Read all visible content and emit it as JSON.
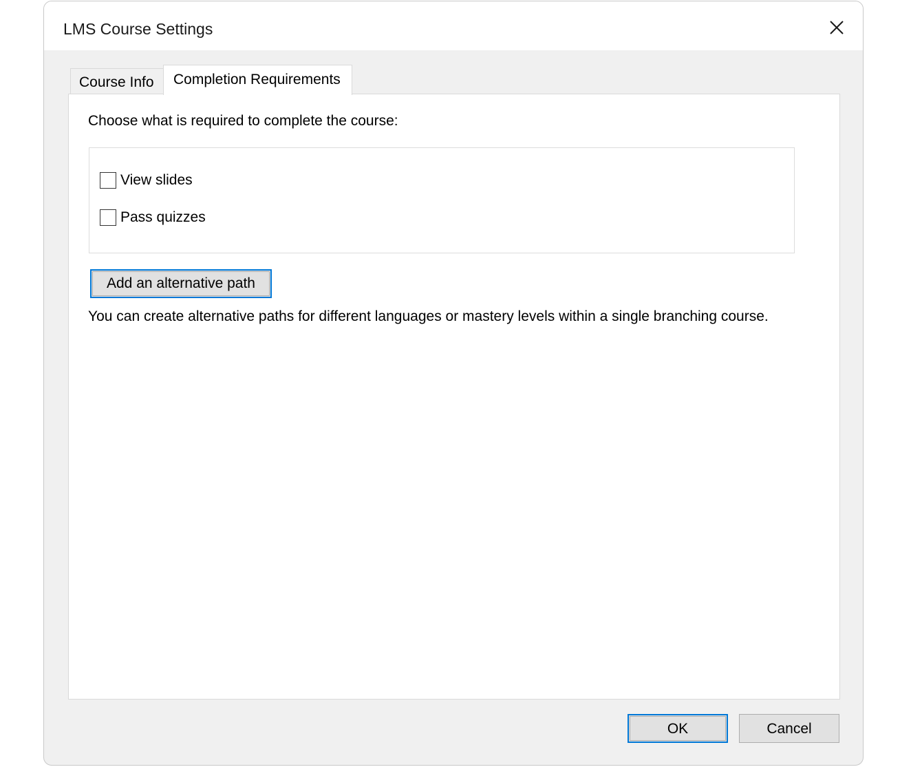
{
  "window": {
    "title": "LMS Course Settings",
    "close_icon": "close-icon"
  },
  "tabs": [
    {
      "label": "Course Info",
      "active": false
    },
    {
      "label": "Completion Requirements",
      "active": true
    }
  ],
  "completion": {
    "instruction": "Choose what is required to complete the course:",
    "options": [
      {
        "label": "View slides",
        "checked": false
      },
      {
        "label": "Pass quizzes",
        "checked": false
      }
    ],
    "alt_path_button": "Add an alternative path",
    "help_text": "You can create alternative paths for different languages or mastery levels within a single branching course."
  },
  "footer": {
    "ok_label": "OK",
    "cancel_label": "Cancel"
  },
  "colors": {
    "accent": "#0078d7",
    "dialog_bg": "#f0f0f0",
    "panel_bg": "#ffffff"
  }
}
